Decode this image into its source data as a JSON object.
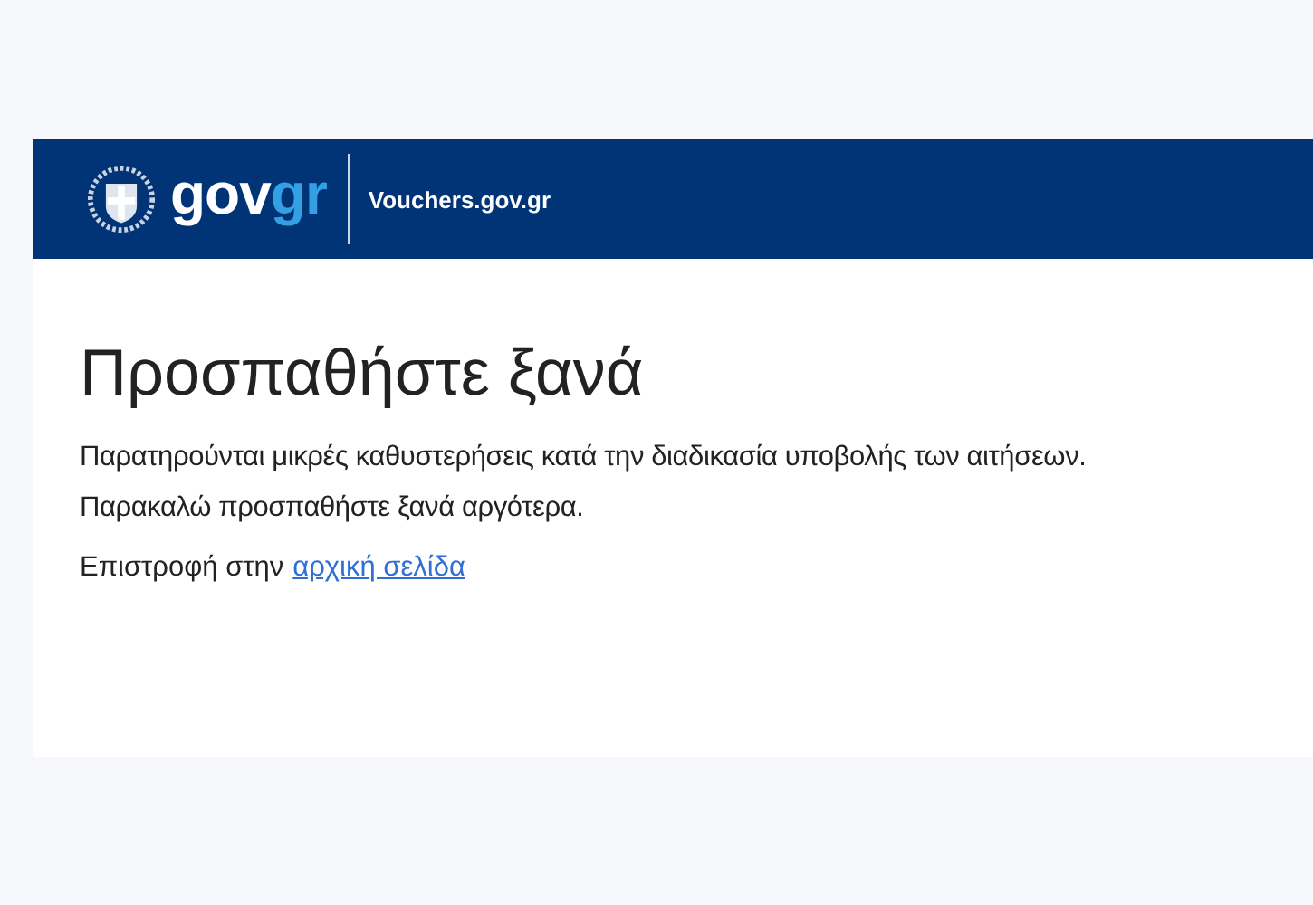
{
  "header": {
    "brand": {
      "main": "gov",
      "accent": "gr"
    },
    "site_name": "Vouchers.gov.gr"
  },
  "content": {
    "title": "Προσπαθήστε ξανά",
    "message_lines": [
      "Παρατηρούνται μικρές καθυστερήσεις κατά την διαδικασία υποβολής των αιτήσεων.",
      "Παρακαλώ προσπαθήστε ξανά αργότερα."
    ],
    "return_text": "Επιστροφή στην",
    "return_link": "αρχική σελίδα"
  }
}
